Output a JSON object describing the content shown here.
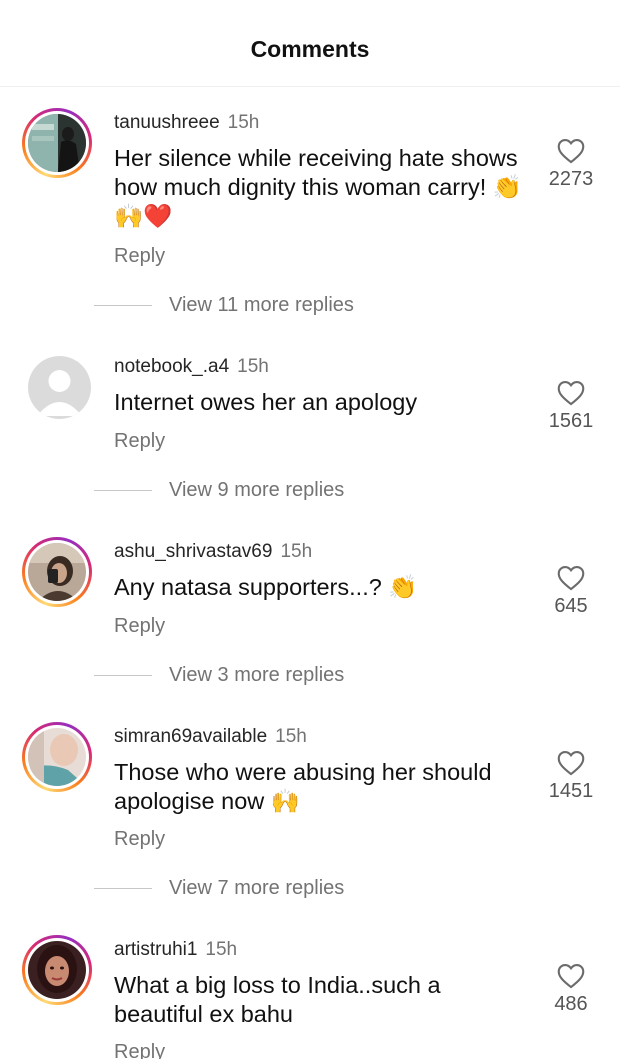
{
  "header": {
    "title": "Comments"
  },
  "comments": [
    {
      "username": "tanuushreee",
      "time": "15h",
      "text": "Her silence while receiving hate shows how much dignity this woman carry! 👏🙌❤️",
      "likes": "2273",
      "reply_label": "Reply",
      "view_replies": "View 11 more replies",
      "has_story_ring": true
    },
    {
      "username": "notebook_.a4",
      "time": "15h",
      "text": "Internet owes her an apology",
      "likes": "1561",
      "reply_label": "Reply",
      "view_replies": "View 9 more replies",
      "has_story_ring": false
    },
    {
      "username": "ashu_shrivastav69",
      "time": "15h",
      "text": "Any natasa supporters...? 👏",
      "likes": "645",
      "reply_label": "Reply",
      "view_replies": "View 3 more replies",
      "has_story_ring": true
    },
    {
      "username": "simran69available",
      "time": "15h",
      "text": "Those who were abusing her should apologise now 🙌",
      "likes": "1451",
      "reply_label": "Reply",
      "view_replies": "View 7 more replies",
      "has_story_ring": true
    },
    {
      "username": "artistruhi1",
      "time": "15h",
      "text": "What a big loss to India..such a beautiful ex bahu",
      "likes": "486",
      "reply_label": "Reply",
      "has_story_ring": true
    }
  ],
  "icons": {
    "like": "heart-outline-icon",
    "default_avatar": "default-user-icon"
  },
  "colors": {
    "story_ring_start": "#feda75",
    "story_ring_mid": "#d62976",
    "story_ring_end": "#962fbf",
    "secondary_text": "#737373"
  }
}
